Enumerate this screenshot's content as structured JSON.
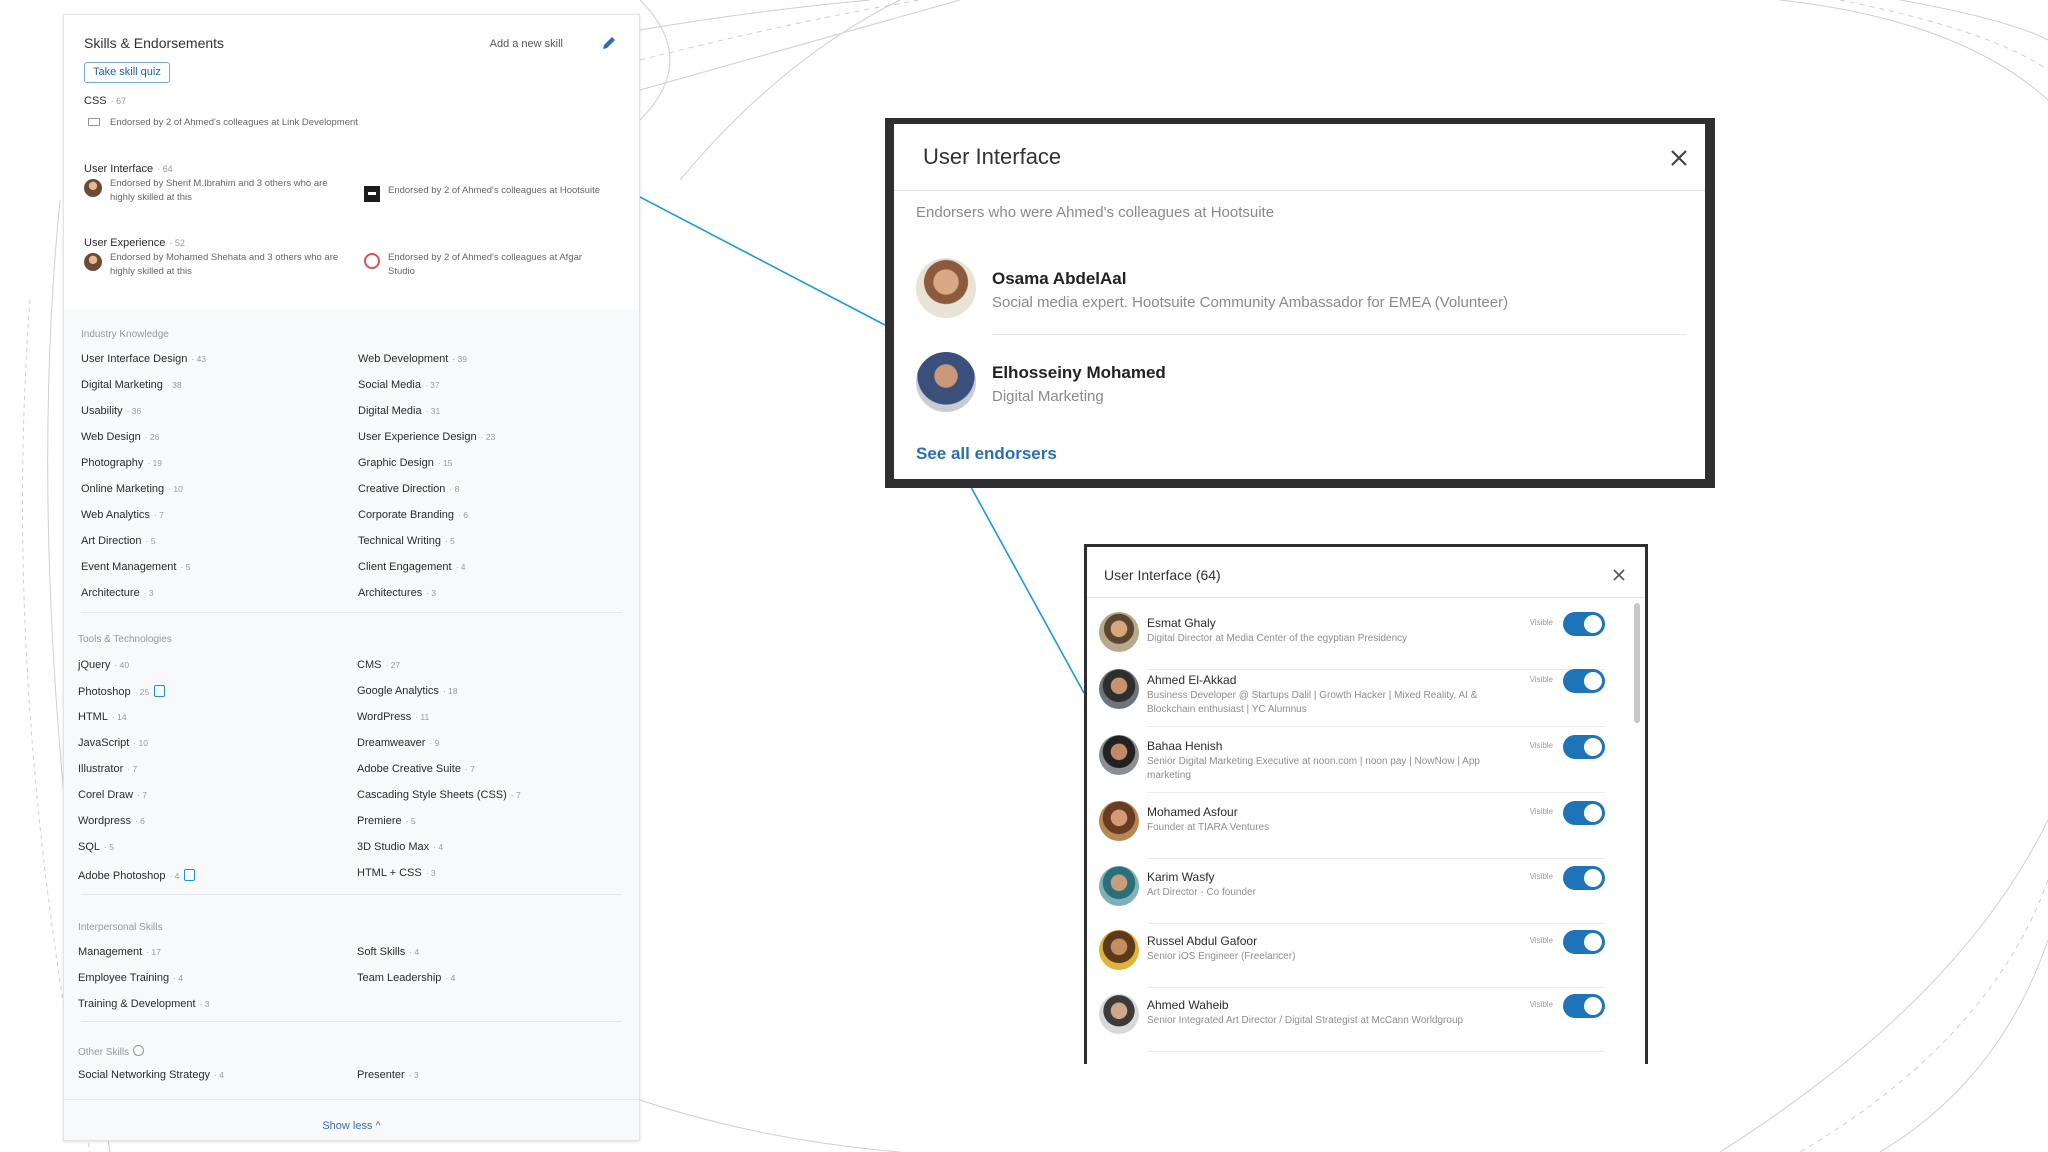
{
  "colors": {
    "connector": "#1a9ad6",
    "link": "#2a6fb3",
    "toggle_on": "#1d74b8",
    "modal_frame": "#2f2f31"
  },
  "skills_panel": {
    "title": "Skills & Endorsements",
    "add_skill": "Add a new skill",
    "edit_icon": "pencil-icon",
    "quiz_button": "Take skill quiz",
    "top_skills": [
      {
        "name": "CSS",
        "count": "· 67",
        "endorsements": [
          {
            "text": "Endorsed by 2 of Ahmed's colleagues at Link Development"
          }
        ]
      },
      {
        "name": "User Interface",
        "count": "· 64",
        "endorsements": [
          {
            "text": "Endorsed by Sherif M.Ibrahim and 3 others who are highly skilled at this"
          },
          {
            "text": "Endorsed by 2 of Ahmed's colleagues at Hootsuite"
          }
        ]
      },
      {
        "name": "User Experience",
        "count": "· 52",
        "endorsements": [
          {
            "text": "Endorsed by Mohamed Shehata and 3 others who are highly skilled at this"
          },
          {
            "text": "Endorsed by 2 of Ahmed's colleagues at Afgar Studio"
          }
        ]
      }
    ],
    "categories": [
      {
        "title": "Industry Knowledge",
        "skills": [
          {
            "name": "User Interface Design",
            "count": "· 43"
          },
          {
            "name": "Web Development",
            "count": "· 39"
          },
          {
            "name": "Digital Marketing",
            "count": "· 38"
          },
          {
            "name": "Social Media",
            "count": "· 37"
          },
          {
            "name": "Usability",
            "count": "· 36"
          },
          {
            "name": "Digital Media",
            "count": "· 31"
          },
          {
            "name": "Web Design",
            "count": "· 26"
          },
          {
            "name": "User Experience Design",
            "count": "· 23"
          },
          {
            "name": "Photography",
            "count": "· 19"
          },
          {
            "name": "Graphic Design",
            "count": "· 15"
          },
          {
            "name": "Online Marketing",
            "count": "· 10"
          },
          {
            "name": "Creative Direction",
            "count": "· 8"
          },
          {
            "name": "Web Analytics",
            "count": "· 7"
          },
          {
            "name": "Corporate Branding",
            "count": "· 6"
          },
          {
            "name": "Art Direction",
            "count": "· 5"
          },
          {
            "name": "Technical Writing",
            "count": "· 5"
          },
          {
            "name": "Event Management",
            "count": "· 5"
          },
          {
            "name": "Client Engagement",
            "count": "· 4"
          },
          {
            "name": "Architecture",
            "count": "· 3"
          },
          {
            "name": "Architectures",
            "count": "· 3"
          }
        ]
      },
      {
        "title": "Tools & Technologies",
        "skills": [
          {
            "name": "jQuery",
            "count": "· 40"
          },
          {
            "name": "CMS",
            "count": "· 27"
          },
          {
            "name": "Photoshop",
            "count": "· 25"
          },
          {
            "name": "Google Analytics",
            "count": "· 18"
          },
          {
            "name": "HTML",
            "count": "· 14"
          },
          {
            "name": "WordPress",
            "count": "· 11"
          },
          {
            "name": "JavaScript",
            "count": "· 10"
          },
          {
            "name": "Dreamweaver",
            "count": "· 9"
          },
          {
            "name": "Illustrator",
            "count": "· 7"
          },
          {
            "name": "Adobe Creative Suite",
            "count": "· 7"
          },
          {
            "name": "Corel Draw",
            "count": "· 7"
          },
          {
            "name": "Cascading Style Sheets (CSS)",
            "count": "· 7"
          },
          {
            "name": "Wordpress",
            "count": "· 6"
          },
          {
            "name": "Premiere",
            "count": "· 5"
          },
          {
            "name": "SQL",
            "count": "· 5"
          },
          {
            "name": "3D Studio Max",
            "count": "· 4"
          },
          {
            "name": "Adobe Photoshop",
            "count": "· 4"
          },
          {
            "name": "HTML + CSS",
            "count": "· 3"
          }
        ]
      },
      {
        "title": "Interpersonal Skills",
        "skills": [
          {
            "name": "Management",
            "count": "· 17"
          },
          {
            "name": "Soft Skills",
            "count": "· 4"
          },
          {
            "name": "Employee Training",
            "count": "· 4"
          },
          {
            "name": "Team Leadership",
            "count": "· 4"
          },
          {
            "name": "Training & Development",
            "count": "· 3"
          }
        ]
      },
      {
        "title": "Other Skills",
        "skills": [
          {
            "name": "Social Networking Strategy",
            "count": "· 4"
          },
          {
            "name": "Presenter",
            "count": "· 3"
          }
        ]
      }
    ],
    "show_less": "Show less ^"
  },
  "endorsers_modal": {
    "title": "User Interface",
    "subtitle": "Endorsers who were Ahmed's colleagues at Hootsuite",
    "people": [
      {
        "name": "Osama AbdelAal",
        "headline": "Social media expert. Hootsuite Community Ambassador for EMEA (Volunteer)"
      },
      {
        "name": "Elhosseiny Mohamed",
        "headline": "Digital Marketing"
      }
    ],
    "see_all": "See all endorsers"
  },
  "list_modal": {
    "title": "User Interface (64)",
    "visible_label": "Visible",
    "people": [
      {
        "name": "Esmat Ghaly",
        "headline": "Digital Director at Media Center of the egyptian Presidency"
      },
      {
        "name": "Ahmed El-Akkad",
        "headline": "Business Developer @ Startups Dalil | Growth Hacker | Mixed Reality, AI & Blockchain enthusiast | YC Alumnus"
      },
      {
        "name": "Bahaa Henish",
        "headline": "Senior Digital Marketing Executive at noon.com | noon pay | NowNow | App marketing"
      },
      {
        "name": "Mohamed Asfour",
        "headline": "Founder at TIARA Ventures"
      },
      {
        "name": "Karim Wasfy",
        "headline": "Art Director - Co founder"
      },
      {
        "name": "Russel Abdul Gafoor",
        "headline": "Senior iOS Engineer (Freelancer)"
      },
      {
        "name": "Ahmed Waheib",
        "headline": "Senior Integrated Art Director / Digital Strategist at McCann Worldgroup"
      }
    ]
  }
}
